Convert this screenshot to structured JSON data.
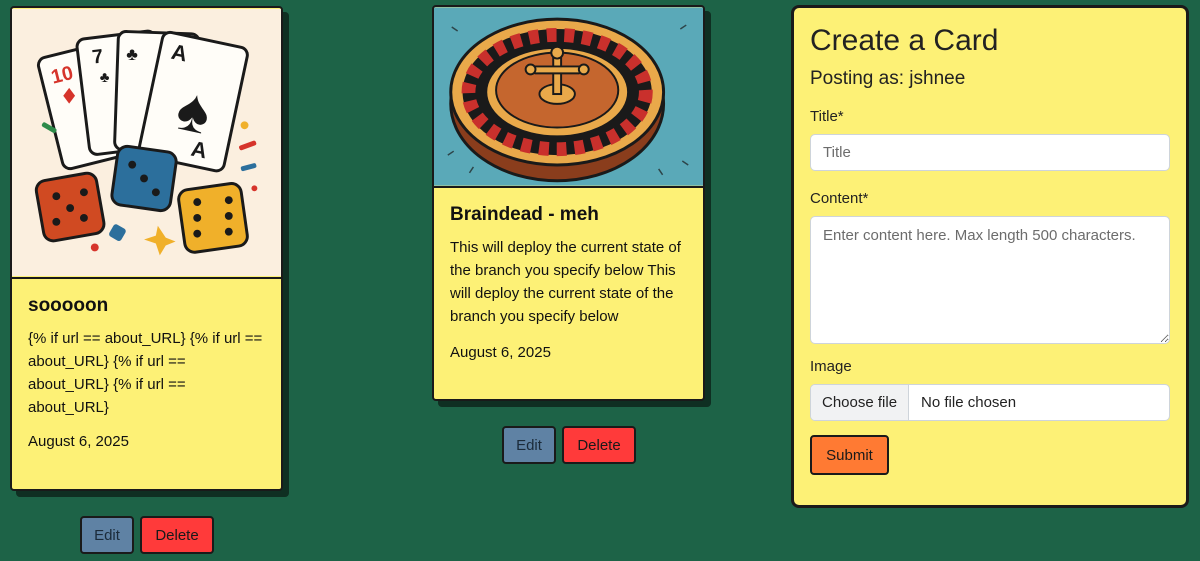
{
  "cards": [
    {
      "title": "sooooon",
      "content": "{% if url == about_URL} {% if url == about_URL} {% if url == about_URL} {% if url == about_URL}",
      "date": "August 6, 2025",
      "image_icon": "playing-cards-and-dice-icon",
      "edit_label": "Edit",
      "delete_label": "Delete"
    },
    {
      "title": "Braindead - meh",
      "content": "This will deploy the current state of the branch you specify below This will deploy the current state of the branch you specify below",
      "date": "August 6, 2025",
      "image_icon": "roulette-wheel-icon",
      "edit_label": "Edit",
      "delete_label": "Delete"
    }
  ],
  "form": {
    "heading": "Create a Card",
    "posting_as": "Posting as: jshnee",
    "title_label": "Title*",
    "title_placeholder": "Title",
    "content_label": "Content*",
    "content_placeholder": "Enter content here. Max length 500 characters.",
    "image_label": "Image",
    "choose_file_label": "Choose file",
    "file_status": "No file chosen",
    "submit_label": "Submit"
  },
  "colors": {
    "background": "#1d6347",
    "card": "#fdf176",
    "edit_button": "#5f82a4",
    "delete_button": "#ff3a3a",
    "submit_button": "#ff7a33"
  }
}
